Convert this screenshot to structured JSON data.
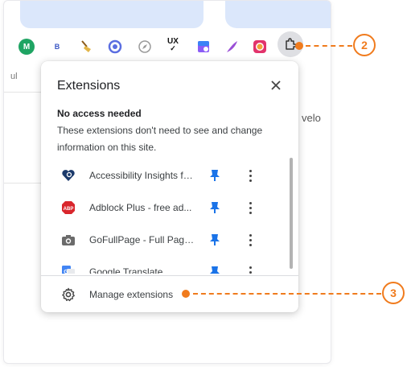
{
  "toolbar": {
    "icons": [
      {
        "name": "mm-icon",
        "label": "M",
        "color": "#1fa463"
      },
      {
        "name": "b-icon",
        "label": "B",
        "color": "#3b57c4"
      },
      {
        "name": "broom-icon",
        "label": "",
        "color": "#c68b2c"
      },
      {
        "name": "q-icon",
        "label": "",
        "color": "#5b6ee1"
      },
      {
        "name": "compass-icon",
        "label": "",
        "color": "#9a9a9a"
      },
      {
        "name": "ux-icon",
        "label": "UX",
        "color": "#111111"
      },
      {
        "name": "calendar-icon",
        "label": "",
        "color": "#8b5cf6"
      },
      {
        "name": "feather-icon",
        "label": "",
        "color": "#9a4fd6"
      },
      {
        "name": "camera-ring-icon",
        "label": "",
        "color": "#e2336b"
      }
    ]
  },
  "page": {
    "left_fragment": "ul",
    "right_fragment": "velo"
  },
  "popup": {
    "title": "Extensions",
    "section_title": "No access needed",
    "section_desc": "These extensions don't need to see and change information on this site.",
    "extensions": [
      {
        "name": "Accessibility Insights fo...",
        "icon": "heart-magnifier-icon"
      },
      {
        "name": "Adblock Plus - free ad...",
        "icon": "abp-icon"
      },
      {
        "name": "GoFullPage - Full Page...",
        "icon": "camera-icon"
      },
      {
        "name": "Google Translate",
        "icon": "translate-icon"
      }
    ],
    "footer_label": "Manage extensions"
  },
  "callouts": {
    "first": "2",
    "second": "3"
  },
  "colors": {
    "accent": "#f07b1d",
    "pin": "#1a73e8",
    "tab": "#dbe7fb"
  }
}
